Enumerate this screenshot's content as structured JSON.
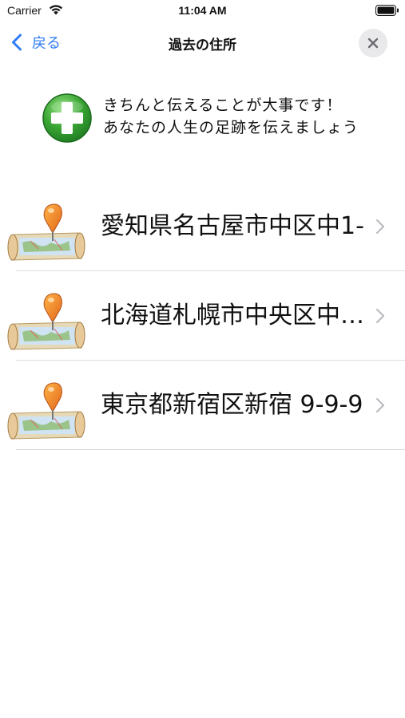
{
  "status_bar": {
    "carrier": "Carrier",
    "time": "11:04 AM"
  },
  "nav": {
    "back_label": "戻る",
    "title": "過去の住所",
    "accent_color": "#2f7cf6"
  },
  "add_section": {
    "line1": "きちんと伝えることが大事です！",
    "line2": "あなたの人生の足跡を伝えましょう",
    "icon": "green-plus-icon"
  },
  "addresses": [
    {
      "text": "愛知県名古屋市中区中1-",
      "icon": "map-pin-icon"
    },
    {
      "text": "北海道札幌市中央区中…",
      "icon": "map-pin-icon"
    },
    {
      "text": "東京都新宿区新宿 9-9-9",
      "icon": "map-pin-icon"
    }
  ]
}
